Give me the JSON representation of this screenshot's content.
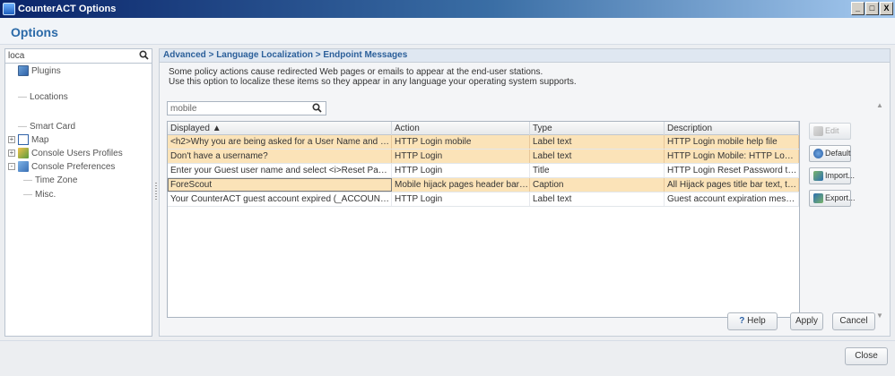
{
  "window": {
    "title": "CounterACT Options",
    "buttons": [
      "_",
      "□",
      "X"
    ]
  },
  "header": {
    "title": "Options"
  },
  "sidebar": {
    "search_value": "loca",
    "items": [
      {
        "label": "Plugins",
        "icon": "plugin-icon"
      },
      {
        "label": "Locations"
      },
      {
        "label": "Smart Card"
      },
      {
        "label": "Map",
        "icon": "map-icon",
        "expander": "+"
      },
      {
        "label": "Console Users Profiles",
        "icon": "users-icon",
        "expander": "+"
      },
      {
        "label": "Console Preferences",
        "icon": "preferences-icon",
        "expander": "-"
      },
      {
        "label": "Time Zone"
      },
      {
        "label": "Misc."
      }
    ]
  },
  "main": {
    "breadcrumb": "Advanced > Language Localization > Endpoint Messages",
    "description_line1": "Some policy actions cause redirected Web pages or emails to appear at the end-user stations.",
    "description_line2": "Use this option to localize these items so they appear in any language your operating system supports.",
    "filter_value": "mobile",
    "columns": [
      "Displayed  ▲",
      "Action",
      "Type",
      "Description"
    ],
    "rows": [
      [
        "<h2>Why you are being asked for a User Name and Pas...",
        "HTTP Login mobile",
        "Label text",
        "HTTP Login mobile help file"
      ],
      [
        "Don't have a username?",
        "HTTP Login",
        "Label text",
        "HTTP Login Mobile: HTTP Login p..."
      ],
      [
        "Enter your Guest user name and select <i>Reset Passw...",
        "HTTP Login",
        "Title",
        "HTTP Login Reset Password text."
      ],
      [
        "ForeScout",
        "Mobile hijack pages header bar text",
        "Caption",
        "All Hijack pages title bar text, typic..."
      ],
      [
        "Your CounterACT guest account expired (_ACCOUNT_N...",
        "HTTP Login",
        "Label text",
        "Guest account expiration messag..."
      ]
    ],
    "actions": {
      "edit": "Edit",
      "default": "Default",
      "import": "Import...",
      "export": "Export..."
    },
    "help": "Help",
    "apply": "Apply",
    "cancel": "Cancel"
  },
  "footer": {
    "close": "Close"
  }
}
